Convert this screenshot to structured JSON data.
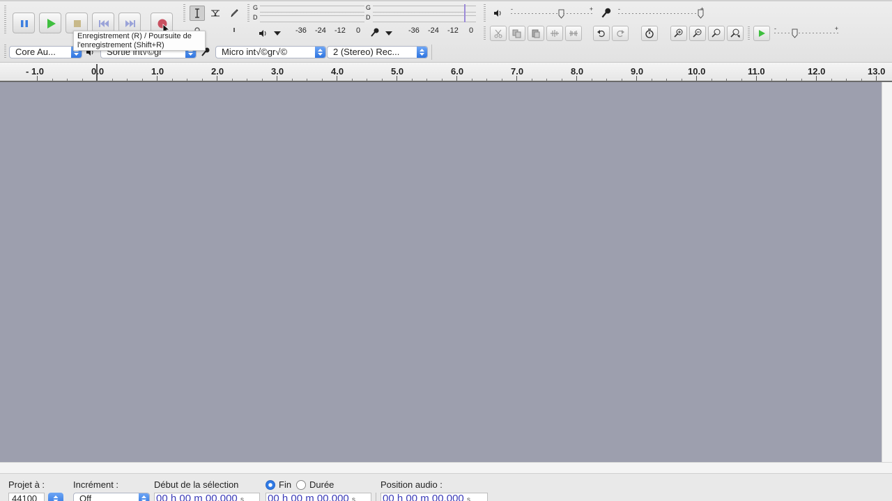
{
  "transport": {
    "pause": "pause-icon",
    "play": "play-icon",
    "stop": "stop-icon",
    "skip_start": "skip-to-start-icon",
    "skip_end": "skip-to-end-icon",
    "record": "record-icon"
  },
  "tooltip": {
    "line1": "Enregistrement (R) / Poursuite de",
    "line2": "l'enregistrement (Shift+R)"
  },
  "meters": {
    "channel_left": "G",
    "channel_right": "D",
    "scale": [
      "-36",
      "-24",
      "-12",
      "0"
    ]
  },
  "devices": {
    "host": "Core Au...",
    "output": "Sortie int√©gr",
    "input": "Micro int√©gr√©",
    "channels": "2 (Stereo) Rec..."
  },
  "ruler": {
    "labels": [
      "- 1.0",
      "0.0",
      "1.0",
      "2.0",
      "3.0",
      "4.0",
      "5.0",
      "6.0",
      "7.0",
      "8.0",
      "9.0",
      "10.0",
      "11.0",
      "12.0",
      "13.0"
    ]
  },
  "selection_bar": {
    "project_rate_label": "Projet à :",
    "project_rate_value": "44100",
    "snap_label": "Incrément :",
    "snap_value": "Off",
    "selection_start_label": "Début de la sélection",
    "end_label": "Fin",
    "length_label": "Durée",
    "audio_position_label": "Position audio :",
    "time_value": "00 h 00 m 00.000",
    "time_unit": "s"
  },
  "colors": {
    "track_background": "#9d9fae",
    "play_green": "#3fbf3f",
    "record_red": "#c85060",
    "accent_blue": "#2e74e0"
  }
}
